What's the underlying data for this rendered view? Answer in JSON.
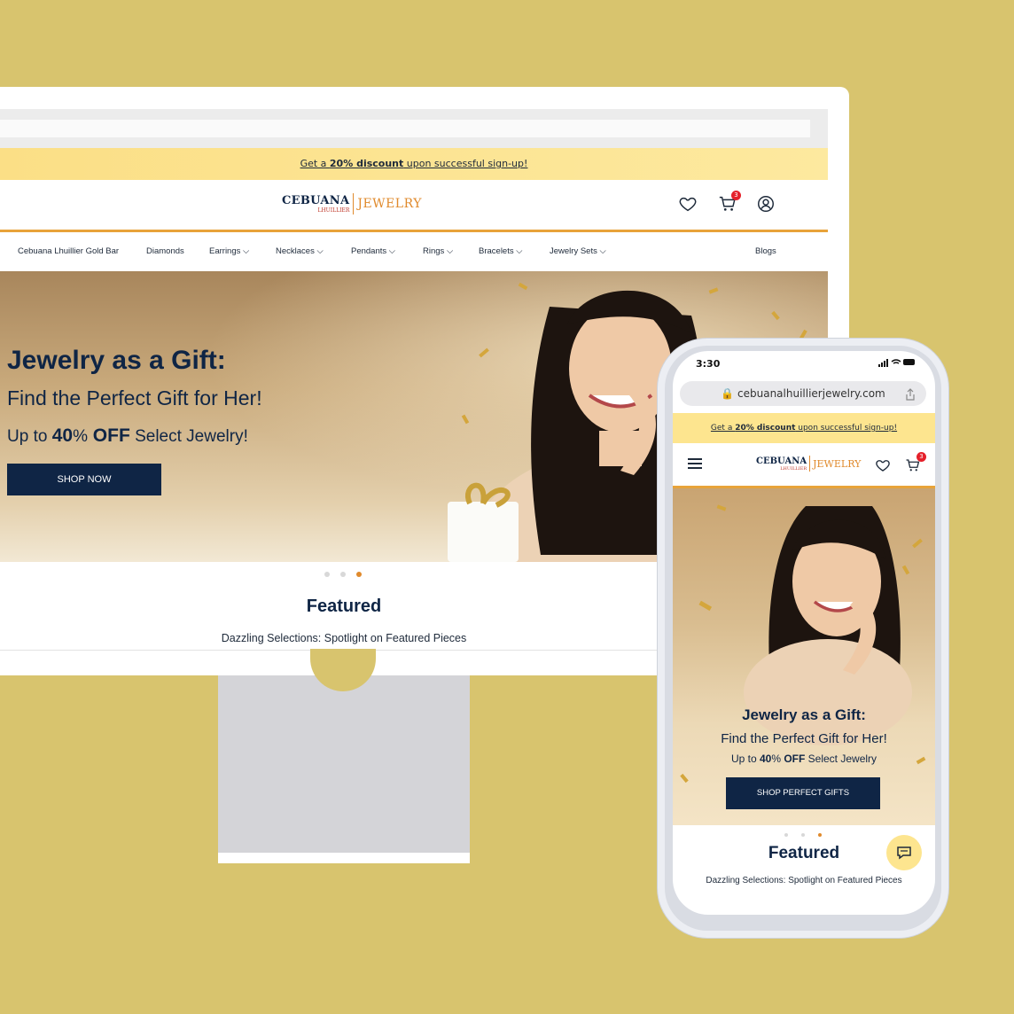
{
  "desktop": {
    "promo": {
      "prefix": "Get a ",
      "highlight": "20% discount",
      "suffix": " upon successful sign-up!"
    },
    "logo": {
      "brand": "CEBUANA",
      "sub": "LHUILLIER",
      "product": "JEWELRY"
    },
    "cart_count": "3",
    "nav": [
      "Cebuana Lhuillier Gold Bar",
      "Diamonds",
      "Earrings",
      "Necklaces",
      "Pendants",
      "Rings",
      "Bracelets",
      "Jewelry Sets",
      "Blogs"
    ],
    "hero": {
      "title": "Jewelry as a Gift:",
      "subtitle": "Find the Perfect Gift for Her!",
      "offer_prefix": "Up to ",
      "offer_value": "40",
      "offer_pct": "%",
      "offer_off": " OFF",
      "offer_suffix": " Select Jewelry!",
      "button": "SHOP NOW"
    },
    "featured": {
      "title": "Featured",
      "subtitle": "Dazzling Selections: Spotlight on Featured Pieces"
    }
  },
  "mobile": {
    "time": "3:30",
    "url": "cebuanalhuillierjewelry.com",
    "promo": {
      "prefix": "Get a ",
      "highlight": "20% discount",
      "suffix": " upon successful sign-up!"
    },
    "cart_count": "3",
    "hero": {
      "title": "Jewelry as a Gift:",
      "subtitle": "Find the Perfect Gift for Her!",
      "offer_prefix": "Up to ",
      "offer_value": "40",
      "offer_pct": "%",
      "offer_off": " OFF",
      "offer_suffix": " Select Jewelry",
      "button": "SHOP PERFECT GIFTS"
    },
    "featured": {
      "title": "Featured",
      "subtitle": "Dazzling Selections: Spotlight on Featured Pieces"
    }
  },
  "colors": {
    "navy": "#0f2545",
    "accent": "#e8a33a",
    "promo": "#fde58f",
    "badge": "#e5202a",
    "background": "#d8c46e"
  },
  "icons": [
    "heart-icon",
    "cart-icon",
    "user-icon",
    "chevron-down-icon",
    "menu-icon",
    "lock-icon",
    "share-icon",
    "chat-icon",
    "signal-icon",
    "wifi-icon",
    "battery-icon"
  ]
}
